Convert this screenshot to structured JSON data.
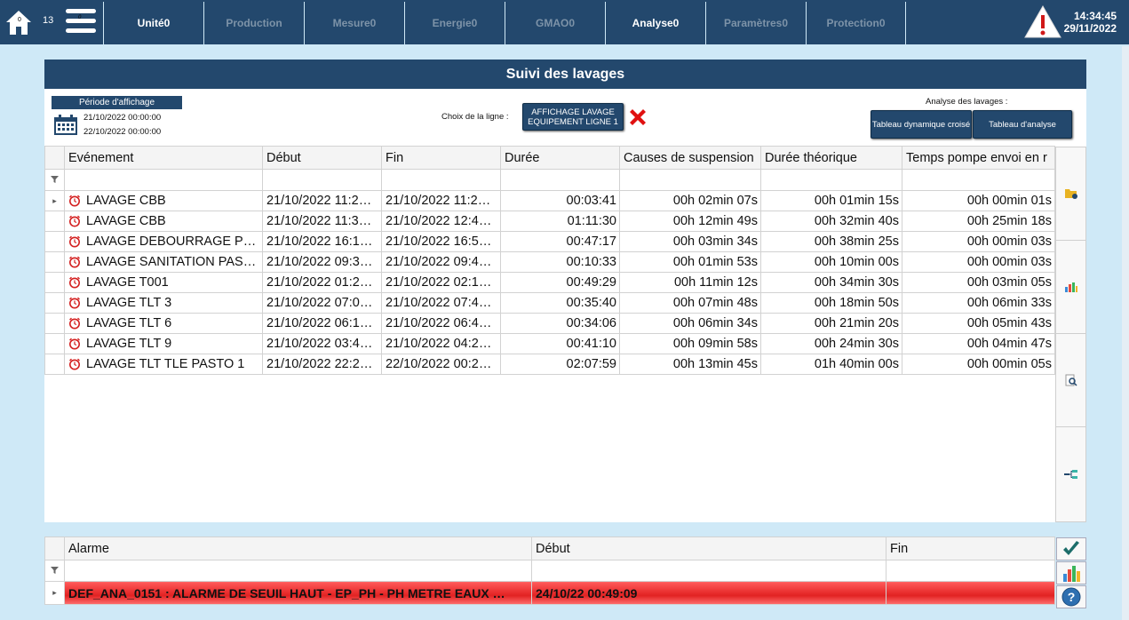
{
  "topbar": {
    "home_badge": "0",
    "count": "13",
    "menu_badge": "0",
    "tabs": [
      {
        "label": "Unité0",
        "active": true
      },
      {
        "label": "Production",
        "active": false
      },
      {
        "label": "Mesure0",
        "active": false
      },
      {
        "label": "Energie0",
        "active": false
      },
      {
        "label": "GMAO0",
        "active": false
      },
      {
        "label": "Analyse0",
        "active": true
      },
      {
        "label": "Paramètres0",
        "active": false
      },
      {
        "label": "Protection0",
        "active": false
      }
    ],
    "time": "14:34:45",
    "date": "29/11/2022"
  },
  "panel": {
    "title": "Suivi des lavages",
    "period_label": "Période d'affichage",
    "date_start": "21/10/2022 00:00:00",
    "date_end": "22/10/2022 00:00:00",
    "line_choice_label": "Choix de la ligne :",
    "line_button": "AFFICHAGE LAVAGE EQUIPEMENT LIGNE 1",
    "analyse_label": "Analyse des lavages :",
    "btn_pivot": "Tableau dynamique croisé",
    "btn_analysis": "Tableau d'analyse"
  },
  "grid": {
    "columns": [
      "Evénement",
      "Début",
      "Fin",
      "Durée",
      "Causes de suspension",
      "Durée théorique",
      "Temps pompe envoi en r"
    ],
    "rows": [
      [
        "LAVAGE CBB",
        "21/10/2022 11:2…",
        "21/10/2022 11:2…",
        "00:03:41",
        "00h 02min 07s",
        "00h 01min 15s",
        "00h 00min 01s"
      ],
      [
        "LAVAGE CBB",
        "21/10/2022 11:3…",
        "21/10/2022 12:4…",
        "01:11:30",
        "00h 12min 49s",
        "00h 32min 40s",
        "00h 25min 18s"
      ],
      [
        "LAVAGE DEBOURRAGE P…",
        "21/10/2022 16:1…",
        "21/10/2022 16:5…",
        "00:47:17",
        "00h 03min 34s",
        "00h 38min 25s",
        "00h 00min 03s"
      ],
      [
        "LAVAGE SANITATION PAS…",
        "21/10/2022 09:3…",
        "21/10/2022 09:4…",
        "00:10:33",
        "00h 01min 53s",
        "00h 10min 00s",
        "00h 00min 03s"
      ],
      [
        "LAVAGE T001",
        "21/10/2022 01:2…",
        "21/10/2022 02:1…",
        "00:49:29",
        "00h 11min 12s",
        "00h 34min 30s",
        "00h 03min 05s"
      ],
      [
        "LAVAGE TLT 3",
        "21/10/2022 07:0…",
        "21/10/2022 07:4…",
        "00:35:40",
        "00h 07min 48s",
        "00h 18min 50s",
        "00h 06min 33s"
      ],
      [
        "LAVAGE TLT 6",
        "21/10/2022 06:1…",
        "21/10/2022 06:4…",
        "00:34:06",
        "00h 06min 34s",
        "00h 21min 20s",
        "00h 05min 43s"
      ],
      [
        "LAVAGE TLT 9",
        "21/10/2022 03:4…",
        "21/10/2022 04:2…",
        "00:41:10",
        "00h 09min 58s",
        "00h 24min 30s",
        "00h 04min 47s"
      ],
      [
        "LAVAGE TLT TLE PASTO 1",
        "21/10/2022 22:2…",
        "22/10/2022 00:2…",
        "02:07:59",
        "00h 13min 45s",
        "01h 40min 00s",
        "00h 00min 05s"
      ]
    ]
  },
  "alarms": {
    "columns": [
      "Alarme",
      "Début",
      "Fin"
    ],
    "rows": [
      [
        "DEF_ANA_0151 : ALARME DE SEUIL HAUT - EP_PH - PH METRE EAUX …",
        "24/10/22 00:49:09",
        ""
      ]
    ]
  },
  "colors": {
    "header": "#23486d",
    "background": "#cfe9f7",
    "alarm_red": "#e22222"
  }
}
